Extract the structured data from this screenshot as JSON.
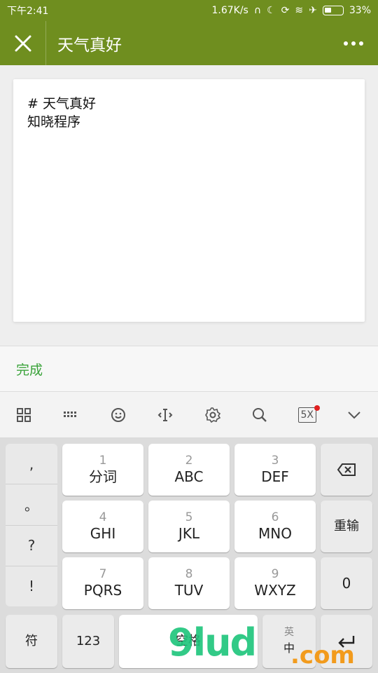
{
  "status": {
    "time": "下午2:41",
    "speed": "1.67K/s",
    "battery": "33%"
  },
  "header": {
    "title": "天气真好"
  },
  "editor": {
    "line1": "# 天气真好",
    "line2": "知晓程序"
  },
  "actions": {
    "done": "完成"
  },
  "keyboard": {
    "punct": [
      ",",
      "。",
      "?",
      "!"
    ],
    "keys": {
      "k1": {
        "num": "1",
        "lbl": "分词"
      },
      "k2": {
        "num": "2",
        "lbl": "ABC"
      },
      "k3": {
        "num": "3",
        "lbl": "DEF"
      },
      "k4": {
        "num": "4",
        "lbl": "GHI"
      },
      "k5": {
        "num": "5",
        "lbl": "JKL"
      },
      "k6": {
        "num": "6",
        "lbl": "MNO"
      },
      "k7": {
        "num": "7",
        "lbl": "PQRS"
      },
      "k8": {
        "num": "8",
        "lbl": "TUV"
      },
      "k9": {
        "num": "9",
        "lbl": "WXYZ"
      }
    },
    "reenter": "重输",
    "zero": "0",
    "symbol": "符",
    "numbers": "123",
    "space": "空格",
    "lang_en": "英",
    "lang_zh": "中",
    "toolbar_5x": "5X"
  },
  "watermark": {
    "main": "9lud",
    "suffix": ".com"
  }
}
